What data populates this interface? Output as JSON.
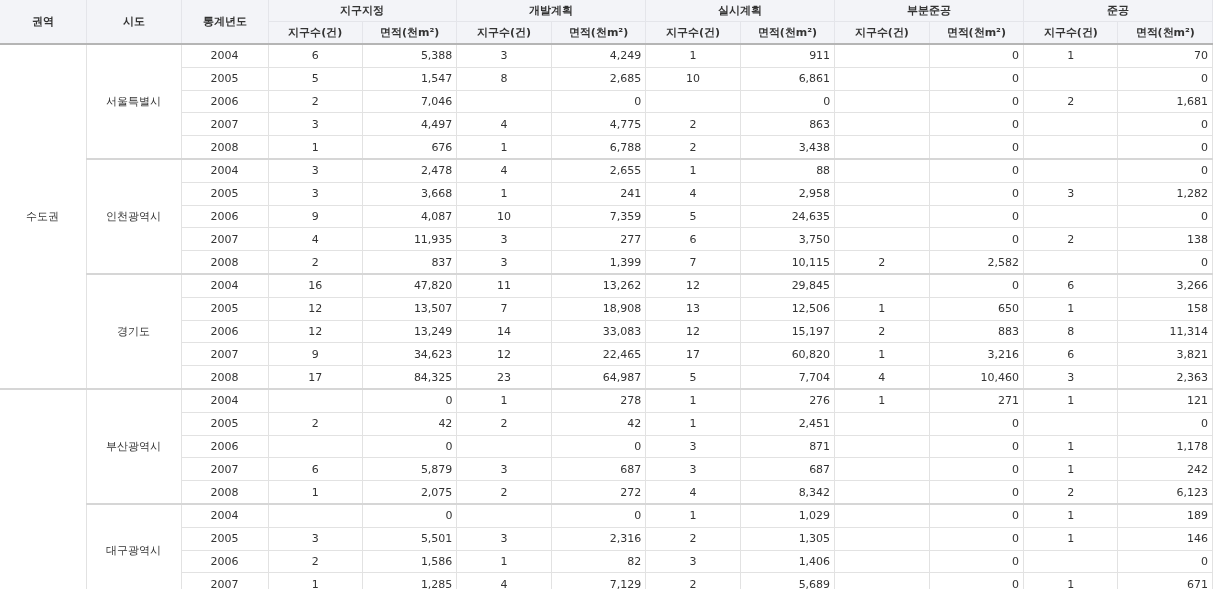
{
  "table": {
    "fixed_headers": [
      {
        "label": "권역"
      },
      {
        "label": "시도"
      },
      {
        "label": "통계년도"
      }
    ],
    "groups": [
      {
        "label": "지구지정",
        "count_label": "지구수(건)",
        "area_label": "면적(천m²)"
      },
      {
        "label": "개발계획",
        "count_label": "지구수(건)",
        "area_label": "면적(천m²)"
      },
      {
        "label": "실시계획",
        "count_label": "지구수(건)",
        "area_label": "면적(천m²)"
      },
      {
        "label": "부분준공",
        "count_label": "지구수(건)",
        "area_label": "면적(천m²)"
      },
      {
        "label": "준공",
        "count_label": "지구수(건)",
        "area_label": "면적(천m²)"
      }
    ],
    "regions": [
      {
        "name": "수도권",
        "cities": [
          {
            "name": "서울특별시",
            "rows": [
              {
                "year": "2004",
                "groups": [
                  {
                    "count": "6",
                    "area": "5,388"
                  },
                  {
                    "count": "3",
                    "area": "4,249"
                  },
                  {
                    "count": "1",
                    "area": "911"
                  },
                  {
                    "area": "0"
                  },
                  {
                    "count": "1",
                    "area": "70"
                  }
                ]
              },
              {
                "year": "2005",
                "groups": [
                  {
                    "count": "5",
                    "area": "1,547"
                  },
                  {
                    "count": "8",
                    "area": "2,685"
                  },
                  {
                    "count": "10",
                    "area": "6,861"
                  },
                  {
                    "area": "0"
                  },
                  {
                    "area": "0"
                  }
                ]
              },
              {
                "year": "2006",
                "groups": [
                  {
                    "count": "2",
                    "area": "7,046"
                  },
                  {
                    "area": "0"
                  },
                  {
                    "area": "0"
                  },
                  {
                    "area": "0"
                  },
                  {
                    "count": "2",
                    "area": "1,681"
                  }
                ]
              },
              {
                "year": "2007",
                "groups": [
                  {
                    "count": "3",
                    "area": "4,497"
                  },
                  {
                    "count": "4",
                    "area": "4,775"
                  },
                  {
                    "count": "2",
                    "area": "863"
                  },
                  {
                    "area": "0"
                  },
                  {
                    "area": "0"
                  }
                ]
              },
              {
                "year": "2008",
                "groups": [
                  {
                    "count": "1",
                    "area": "676"
                  },
                  {
                    "count": "1",
                    "area": "6,788"
                  },
                  {
                    "count": "2",
                    "area": "3,438"
                  },
                  {
                    "area": "0"
                  },
                  {
                    "area": "0"
                  }
                ]
              }
            ]
          },
          {
            "name": "인천광역시",
            "rows": [
              {
                "year": "2004",
                "groups": [
                  {
                    "count": "3",
                    "area": "2,478"
                  },
                  {
                    "count": "4",
                    "area": "2,655"
                  },
                  {
                    "count": "1",
                    "area": "88"
                  },
                  {
                    "area": "0"
                  },
                  {
                    "area": "0"
                  }
                ]
              },
              {
                "year": "2005",
                "groups": [
                  {
                    "count": "3",
                    "area": "3,668"
                  },
                  {
                    "count": "1",
                    "area": "241"
                  },
                  {
                    "count": "4",
                    "area": "2,958"
                  },
                  {
                    "area": "0"
                  },
                  {
                    "count": "3",
                    "area": "1,282"
                  }
                ]
              },
              {
                "year": "2006",
                "groups": [
                  {
                    "count": "9",
                    "area": "4,087"
                  },
                  {
                    "count": "10",
                    "area": "7,359"
                  },
                  {
                    "count": "5",
                    "area": "24,635"
                  },
                  {
                    "area": "0"
                  },
                  {
                    "area": "0"
                  }
                ]
              },
              {
                "year": "2007",
                "groups": [
                  {
                    "count": "4",
                    "area": "11,935"
                  },
                  {
                    "count": "3",
                    "area": "277"
                  },
                  {
                    "count": "6",
                    "area": "3,750"
                  },
                  {
                    "area": "0"
                  },
                  {
                    "count": "2",
                    "area": "138"
                  }
                ]
              },
              {
                "year": "2008",
                "groups": [
                  {
                    "count": "2",
                    "area": "837"
                  },
                  {
                    "count": "3",
                    "area": "1,399"
                  },
                  {
                    "count": "7",
                    "area": "10,115"
                  },
                  {
                    "count": "2",
                    "area": "2,582"
                  },
                  {
                    "area": "0"
                  }
                ]
              }
            ]
          },
          {
            "name": "경기도",
            "rows": [
              {
                "year": "2004",
                "groups": [
                  {
                    "count": "16",
                    "area": "47,820"
                  },
                  {
                    "count": "11",
                    "area": "13,262"
                  },
                  {
                    "count": "12",
                    "area": "29,845"
                  },
                  {
                    "area": "0"
                  },
                  {
                    "count": "6",
                    "area": "3,266"
                  }
                ]
              },
              {
                "year": "2005",
                "groups": [
                  {
                    "count": "12",
                    "area": "13,507"
                  },
                  {
                    "count": "7",
                    "area": "18,908"
                  },
                  {
                    "count": "13",
                    "area": "12,506"
                  },
                  {
                    "count": "1",
                    "area": "650"
                  },
                  {
                    "count": "1",
                    "area": "158"
                  }
                ]
              },
              {
                "year": "2006",
                "groups": [
                  {
                    "count": "12",
                    "area": "13,249"
                  },
                  {
                    "count": "14",
                    "area": "33,083"
                  },
                  {
                    "count": "12",
                    "area": "15,197"
                  },
                  {
                    "count": "2",
                    "area": "883"
                  },
                  {
                    "count": "8",
                    "area": "11,314"
                  }
                ]
              },
              {
                "year": "2007",
                "groups": [
                  {
                    "count": "9",
                    "area": "34,623"
                  },
                  {
                    "count": "12",
                    "area": "22,465"
                  },
                  {
                    "count": "17",
                    "area": "60,820"
                  },
                  {
                    "count": "1",
                    "area": "3,216"
                  },
                  {
                    "count": "6",
                    "area": "3,821"
                  }
                ]
              },
              {
                "year": "2008",
                "groups": [
                  {
                    "count": "17",
                    "area": "84,325"
                  },
                  {
                    "count": "23",
                    "area": "64,987"
                  },
                  {
                    "count": "5",
                    "area": "7,704"
                  },
                  {
                    "count": "4",
                    "area": "10,460"
                  },
                  {
                    "count": "3",
                    "area": "2,363"
                  }
                ]
              }
            ]
          }
        ]
      },
      {
        "cities": [
          {
            "name": "부산광역시",
            "rows": [
              {
                "year": "2004",
                "groups": [
                  {
                    "area": "0"
                  },
                  {
                    "count": "1",
                    "area": "278"
                  },
                  {
                    "count": "1",
                    "area": "276"
                  },
                  {
                    "count": "1",
                    "area": "271"
                  },
                  {
                    "count": "1",
                    "area": "121"
                  }
                ]
              },
              {
                "year": "2005",
                "groups": [
                  {
                    "count": "2",
                    "area": "42"
                  },
                  {
                    "count": "2",
                    "area": "42"
                  },
                  {
                    "count": "1",
                    "area": "2,451"
                  },
                  {
                    "area": "0"
                  },
                  {
                    "area": "0"
                  }
                ]
              },
              {
                "year": "2006",
                "groups": [
                  {
                    "area": "0"
                  },
                  {
                    "area": "0"
                  },
                  {
                    "count": "3",
                    "area": "871"
                  },
                  {
                    "area": "0"
                  },
                  {
                    "count": "1",
                    "area": "1,178"
                  }
                ]
              },
              {
                "year": "2007",
                "groups": [
                  {
                    "count": "6",
                    "area": "5,879"
                  },
                  {
                    "count": "3",
                    "area": "687"
                  },
                  {
                    "count": "3",
                    "area": "687"
                  },
                  {
                    "area": "0"
                  },
                  {
                    "count": "1",
                    "area": "242"
                  }
                ]
              },
              {
                "year": "2008",
                "groups": [
                  {
                    "count": "1",
                    "area": "2,075"
                  },
                  {
                    "count": "2",
                    "area": "272"
                  },
                  {
                    "count": "4",
                    "area": "8,342"
                  },
                  {
                    "area": "0"
                  },
                  {
                    "count": "2",
                    "area": "6,123"
                  }
                ]
              }
            ]
          },
          {
            "name": "대구광역시",
            "rows": [
              {
                "year": "2004",
                "groups": [
                  {
                    "area": "0"
                  },
                  {
                    "area": "0"
                  },
                  {
                    "count": "1",
                    "area": "1,029"
                  },
                  {
                    "area": "0"
                  },
                  {
                    "count": "1",
                    "area": "189"
                  }
                ]
              },
              {
                "year": "2005",
                "groups": [
                  {
                    "count": "3",
                    "area": "5,501"
                  },
                  {
                    "count": "3",
                    "area": "2,316"
                  },
                  {
                    "count": "2",
                    "area": "1,305"
                  },
                  {
                    "area": "0"
                  },
                  {
                    "count": "1",
                    "area": "146"
                  }
                ]
              },
              {
                "year": "2006",
                "groups": [
                  {
                    "count": "2",
                    "area": "1,586"
                  },
                  {
                    "count": "1",
                    "area": "82"
                  },
                  {
                    "count": "3",
                    "area": "1,406"
                  },
                  {
                    "area": "0"
                  },
                  {
                    "area": "0"
                  }
                ]
              },
              {
                "year": "2007",
                "groups": [
                  {
                    "count": "1",
                    "area": "1,285"
                  },
                  {
                    "count": "4",
                    "area": "7,129"
                  },
                  {
                    "count": "2",
                    "area": "5,689"
                  },
                  {
                    "area": "0"
                  },
                  {
                    "count": "1",
                    "area": "671"
                  }
                ]
              }
            ]
          }
        ]
      }
    ]
  }
}
